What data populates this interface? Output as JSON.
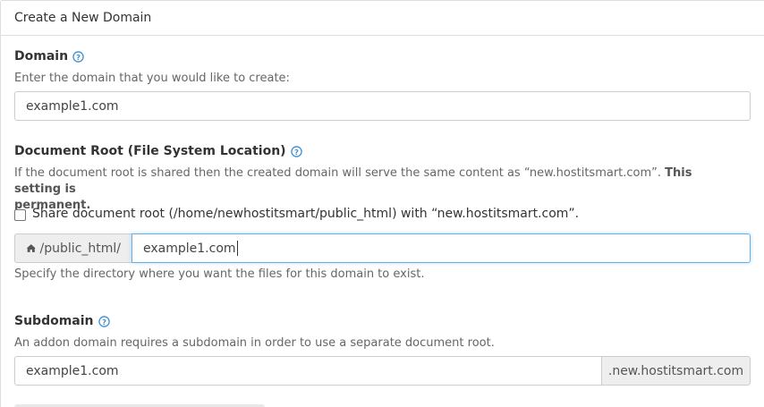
{
  "panel": {
    "title": "Create a New Domain"
  },
  "domain": {
    "label": "Domain",
    "description": "Enter the domain that you would like to create:",
    "value": "example1.com"
  },
  "docroot": {
    "label": "Document Root (File System Location)",
    "description_prefix": "If the document root is shared then the created domain will serve the same content as “new.hostitsmart.com”. ",
    "description_bold_1": "This setting is",
    "description_bold_2": "permanent.",
    "share_checkbox_label": "Share document root (/home/newhostitsmart/public_html) with “new.hostitsmart.com”.",
    "share_checked": false,
    "prefix": "/public_html/",
    "value": "example1.com",
    "hint": "Specify the directory where you want the files for this domain to exist."
  },
  "subdomain": {
    "label": "Subdomain",
    "description": "An addon domain requires a subdomain in order to use a separate document root.",
    "value": "example1.com",
    "suffix": ".new.hostitsmart.com"
  },
  "colors": {
    "help_icon": "#3d8fd6",
    "focus_border": "#66afe9"
  }
}
